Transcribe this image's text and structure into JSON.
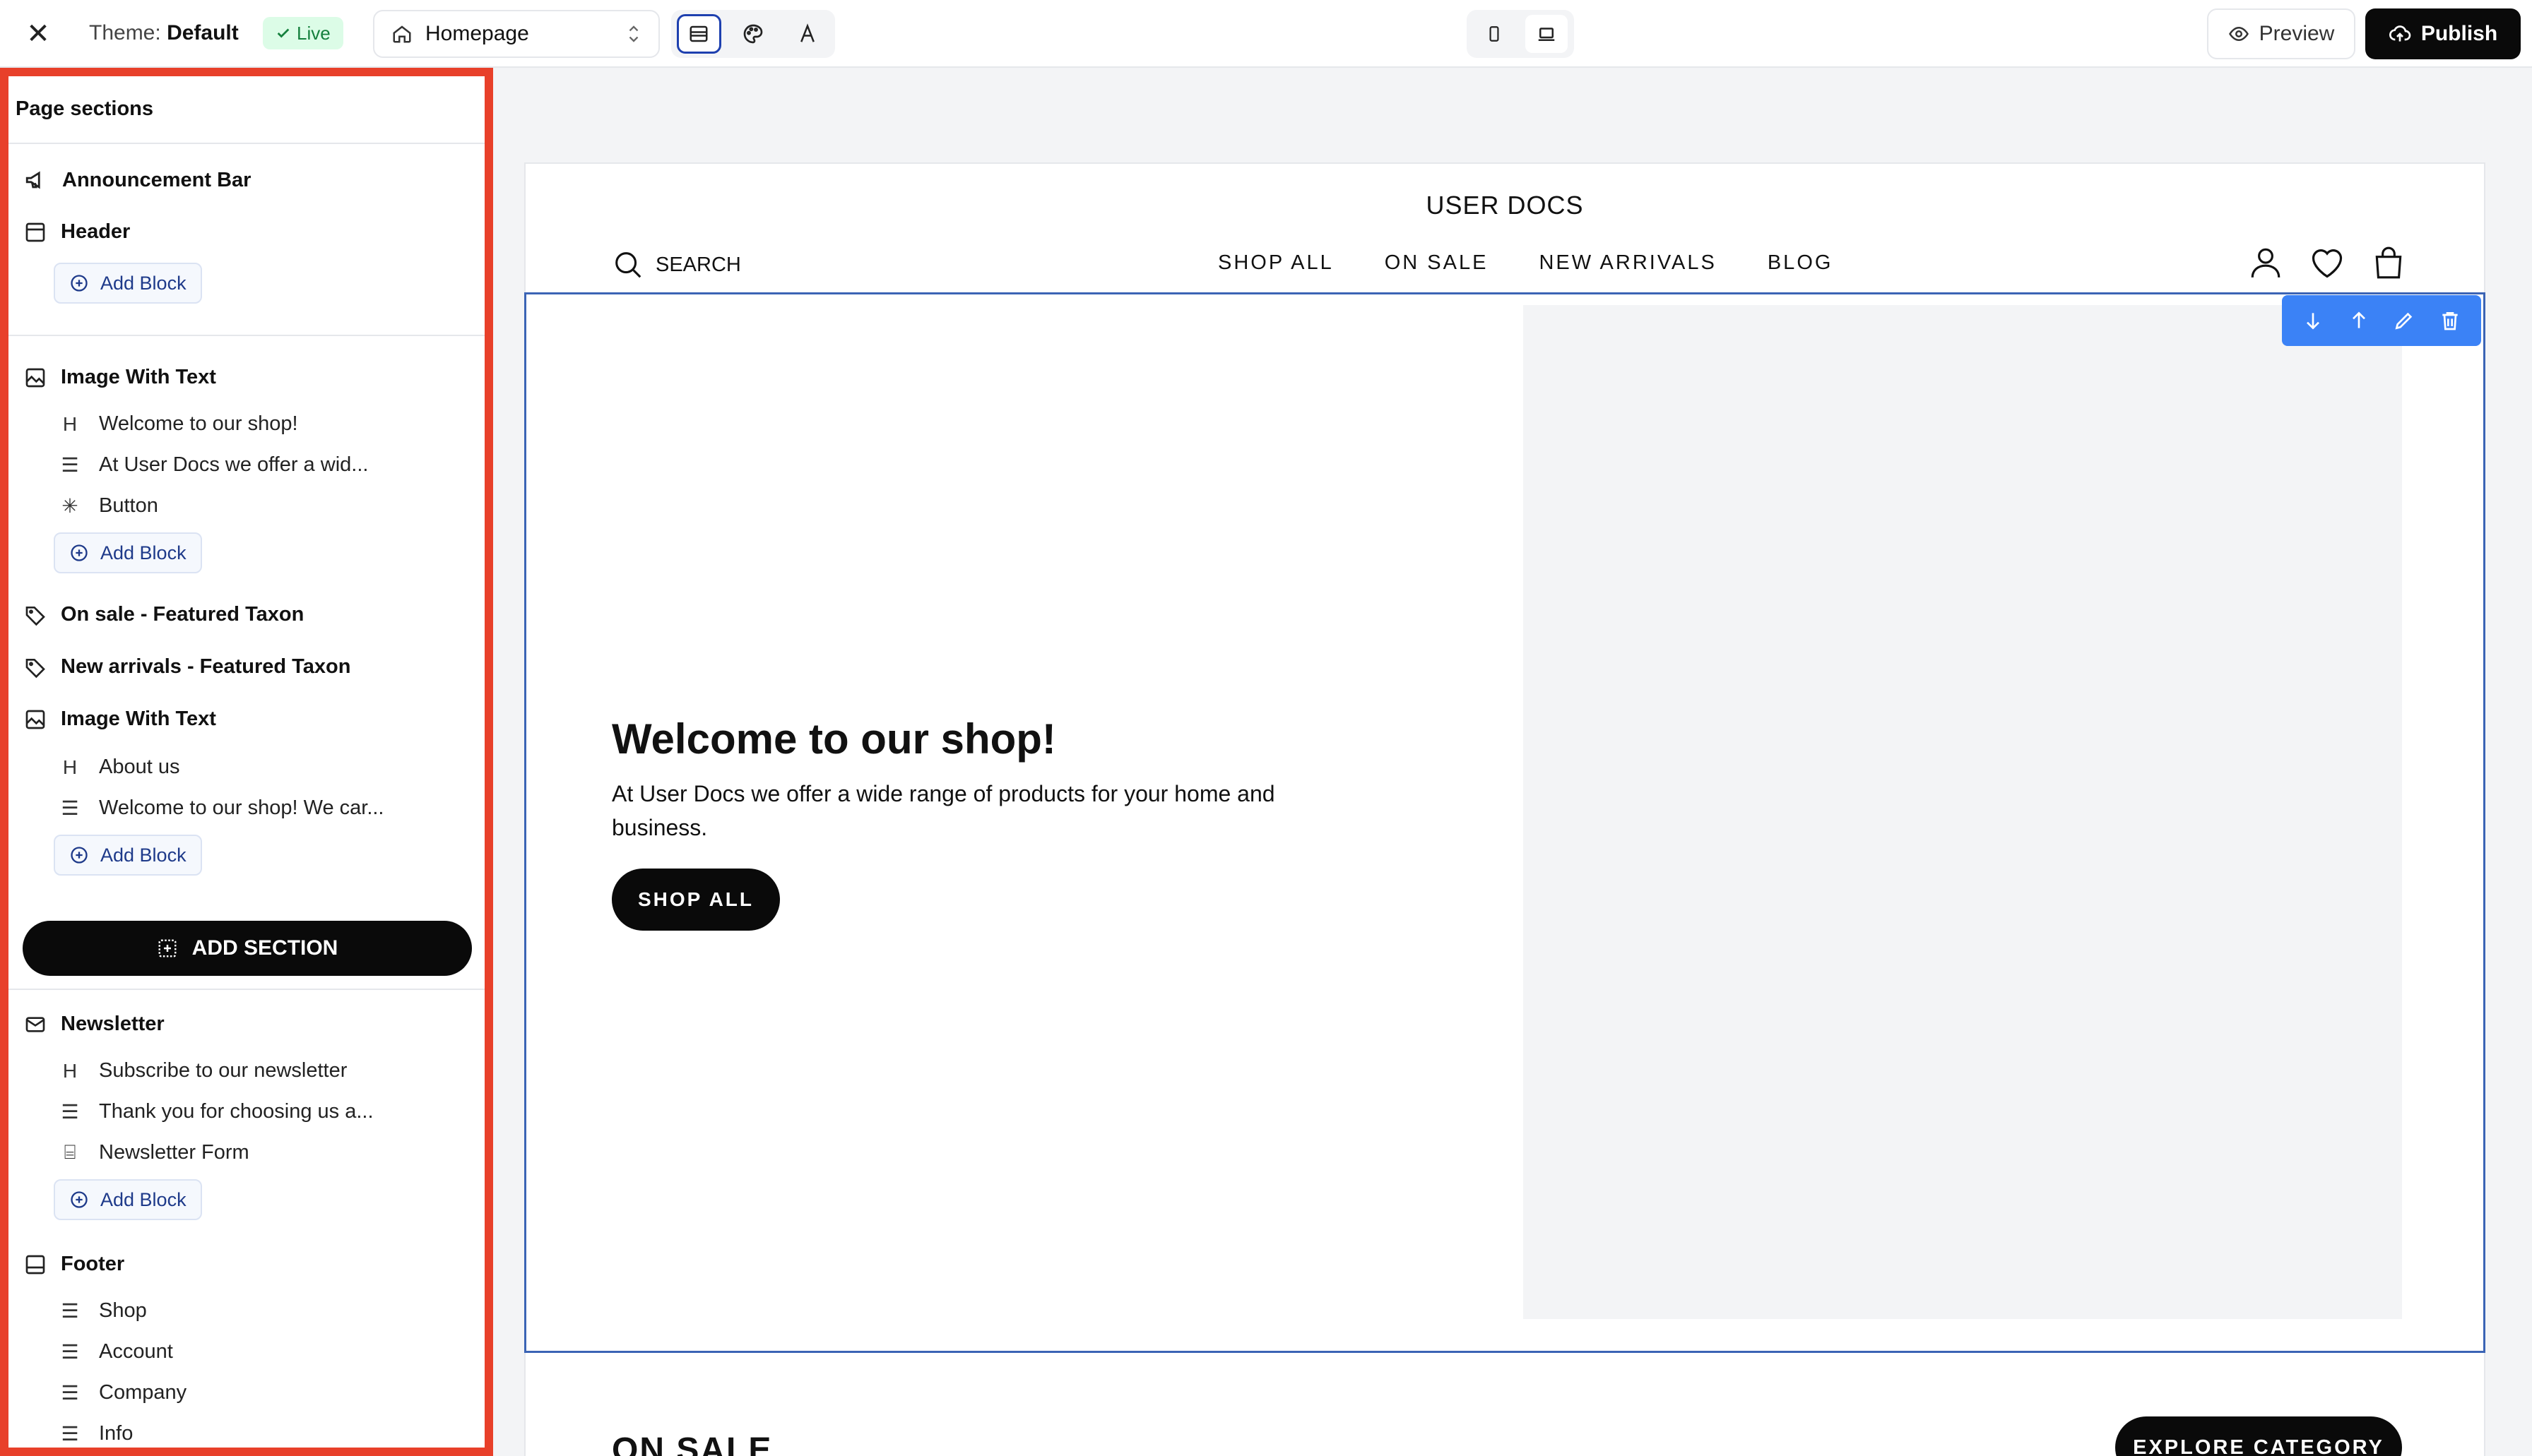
{
  "topbar": {
    "close_glyph": "✕",
    "theme_label": "Theme:",
    "theme_name": "Default",
    "live_badge": "Live",
    "page_selector": "Homepage",
    "preview_label": "Preview",
    "publish_label": "Publish"
  },
  "sidebar": {
    "title": "Page sections",
    "add_block_label": "Add Block",
    "add_section_label": "ADD SECTION",
    "sections": {
      "announcement": "Announcement Bar",
      "header": "Header",
      "image_with_text_1": {
        "title": "Image With Text",
        "blocks": [
          "Welcome to our shop!",
          "At User Docs we offer a wid...",
          "Button"
        ]
      },
      "on_sale": "On sale - Featured Taxon",
      "new_arrivals": "New arrivals - Featured Taxon",
      "image_with_text_2": {
        "title": "Image With Text",
        "blocks": [
          "About us",
          "Welcome to our shop! We car..."
        ]
      },
      "newsletter": {
        "title": "Newsletter",
        "blocks": [
          "Subscribe to our newsletter",
          "Thank you for choosing us a...",
          "Newsletter Form"
        ]
      },
      "footer": {
        "title": "Footer",
        "blocks": [
          "Shop",
          "Account",
          "Company",
          "Info"
        ]
      }
    }
  },
  "preview": {
    "store_name": "USER DOCS",
    "search_label": "SEARCH",
    "nav": [
      "SHOP ALL",
      "ON SALE",
      "NEW ARRIVALS",
      "BLOG"
    ],
    "hero": {
      "title": "Welcome to our shop!",
      "text": "At User Docs we offer a wide range of products for your home and business.",
      "button": "SHOP ALL"
    },
    "next_section_title": "ON SALE",
    "explore_button": "EXPLORE CATEGORY"
  },
  "colors": {
    "accent_blue": "#3b82f6",
    "selection_outline": "#3b64b5",
    "highlight_red": "#e8402a",
    "live_green": "#15803d"
  }
}
